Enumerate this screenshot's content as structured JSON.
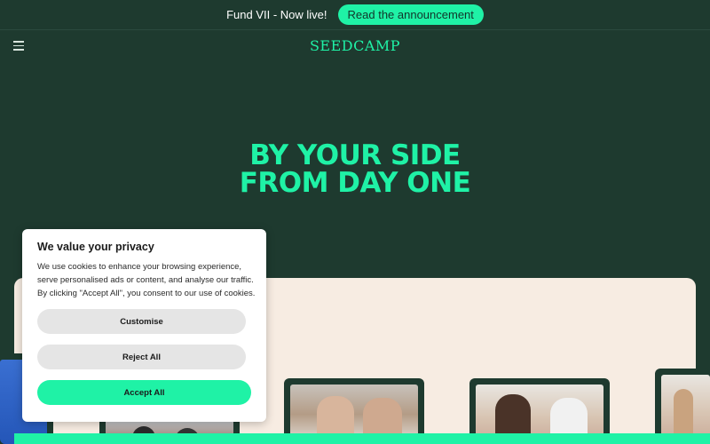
{
  "announcement": {
    "text": "Fund VII - Now live!",
    "button_label": "Read the announcement"
  },
  "header": {
    "logo": "SEEDCAMP",
    "menu_icon": "hamburger-menu-icon"
  },
  "hero": {
    "line1": "BY YOUR SIDE",
    "line2": "FROM DAY ONE"
  },
  "cookie_banner": {
    "title": "We value your privacy",
    "body": "We use cookies to enhance your browsing experience, serve personalised ads or content, and analyse our traffic. By clicking \"Accept All\", you consent to our use of cookies.",
    "customise_label": "Customise",
    "reject_label": "Reject All",
    "accept_label": "Accept All"
  },
  "colors": {
    "background": "#1e3a2f",
    "accent": "#1ff2a6",
    "cream": "#f7ece2"
  }
}
